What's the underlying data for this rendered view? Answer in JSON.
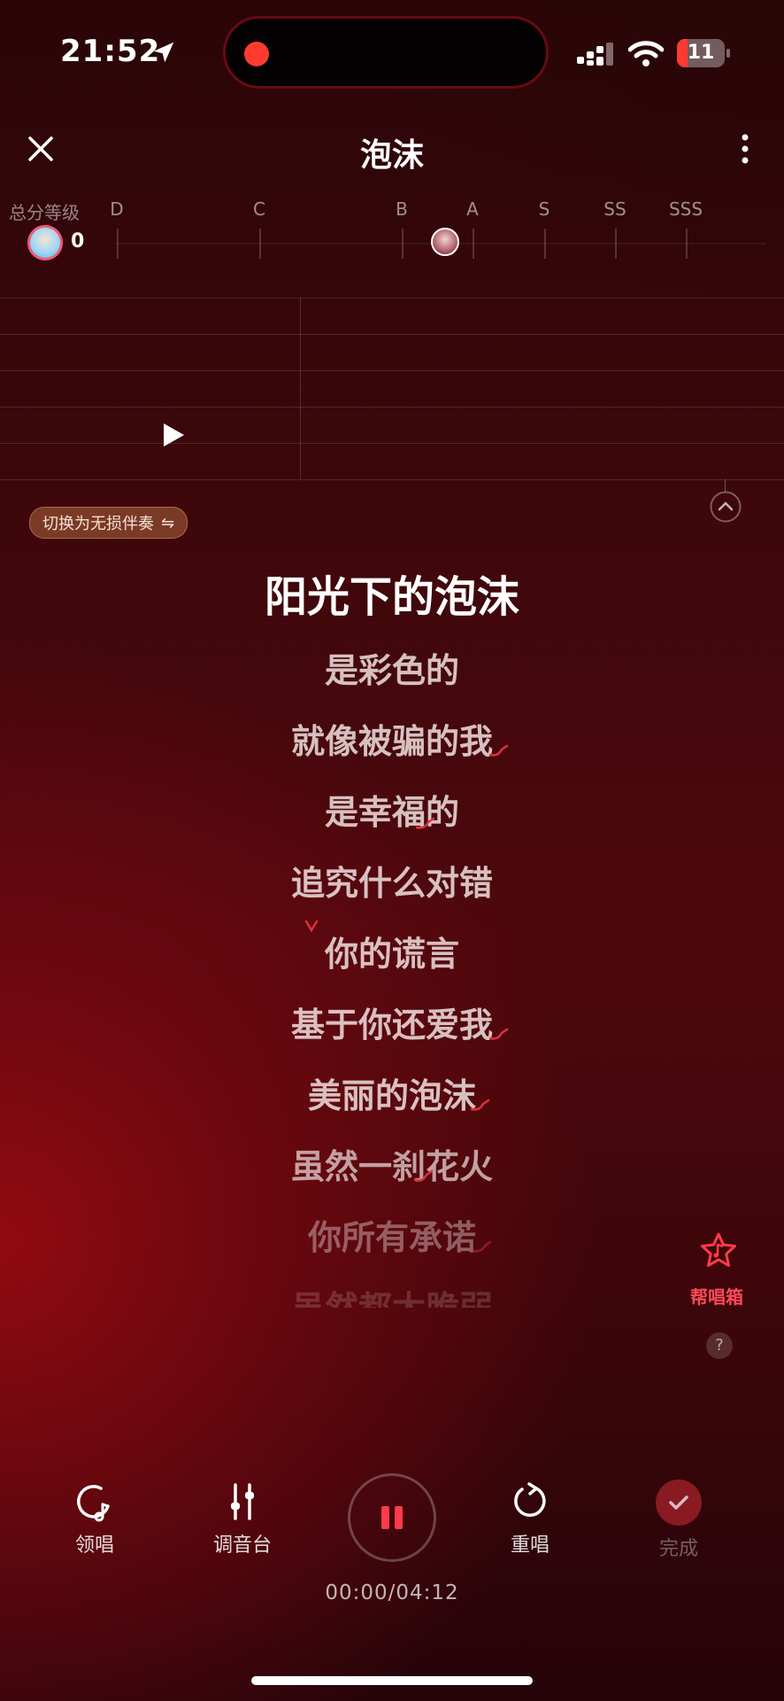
{
  "status_bar": {
    "time": "21:52",
    "battery": "11"
  },
  "header": {
    "title": "泡沫"
  },
  "grade_bar": {
    "label": "总分等级",
    "score": "0",
    "grades": [
      "D",
      "C",
      "B",
      "A",
      "S",
      "SS",
      "SSS"
    ]
  },
  "chip": {
    "label": "切换为无损伴奏",
    "icon": "⇋"
  },
  "lyrics": {
    "current": "阳光下的泡沫",
    "lines": [
      "是彩色的",
      "就像被骗的我",
      "是幸福的",
      "追究什么对错",
      "你的谎言",
      "基于你还爱我",
      "美丽的泡沫",
      "虽然一刹花火",
      "你所有承诺",
      "虽然都太脆弱"
    ]
  },
  "help_box": {
    "label": "帮唱箱",
    "help": "?"
  },
  "controls": {
    "lead": "领唱",
    "mixer": "调音台",
    "restart": "重唱",
    "done": "完成"
  },
  "timer": "00:00/04:12",
  "colors": {
    "accent": "#ff3b4a",
    "background": "#3a070b"
  }
}
